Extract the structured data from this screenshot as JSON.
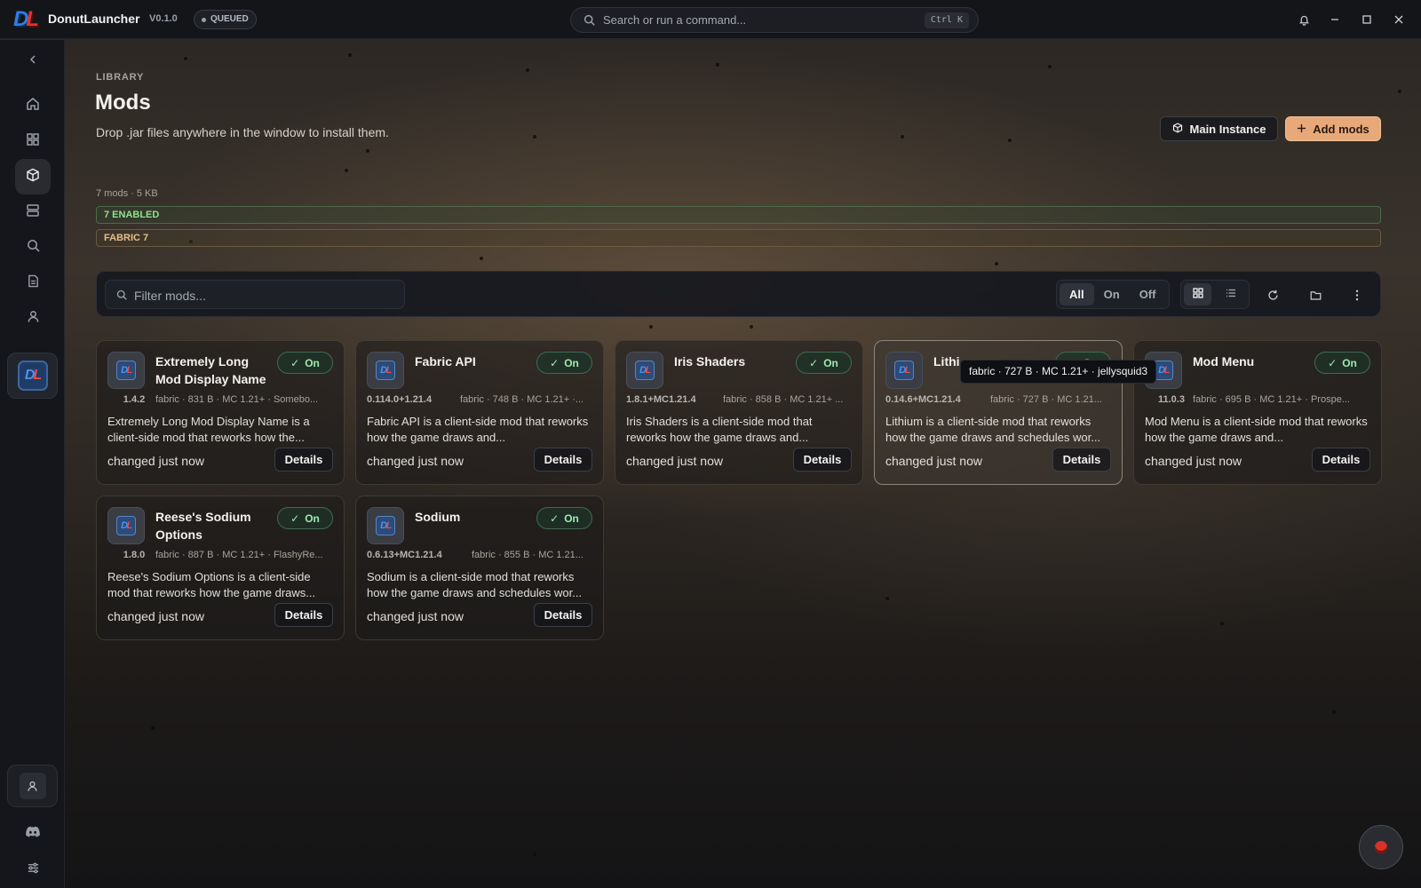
{
  "app": {
    "logo_letters": "DL",
    "name": "DonutLauncher",
    "version": "V0.1.0",
    "status_badge": "QUEUED"
  },
  "command_search": {
    "placeholder": "Search or run a command...",
    "shortcut": "Ctrl K"
  },
  "window_controls": [
    "bell-icon",
    "minimize-icon",
    "maximize-icon",
    "close-icon"
  ],
  "sidebar": {
    "collapse_icon": "chevron-left-icon",
    "items": [
      {
        "icon": "home-icon",
        "active": false
      },
      {
        "icon": "grid-icon",
        "active": false
      },
      {
        "icon": "package-icon",
        "active": true
      },
      {
        "icon": "servers-icon",
        "active": false
      },
      {
        "icon": "search-icon",
        "active": false
      },
      {
        "icon": "document-icon",
        "active": false
      },
      {
        "icon": "user-icon",
        "active": false
      }
    ],
    "instance_logo": "DL",
    "bottom": [
      "account-icon",
      "discord-icon",
      "sliders-icon"
    ]
  },
  "header": {
    "breadcrumb": "LIBRARY",
    "title": "Mods",
    "subtitle": "Drop .jar files anywhere in the window to install them.",
    "main_instance_label": "Main Instance",
    "add_mods_label": "Add mods"
  },
  "summary": {
    "stats": "7 mods · 5 KB",
    "enabled_chip": "7 ENABLED",
    "loader_chip": "FABRIC 7"
  },
  "toolbar": {
    "filter_placeholder": "Filter mods...",
    "filter_value": "",
    "segments": [
      "All",
      "On",
      "Off"
    ],
    "active_segment": "All",
    "view_modes": [
      "grid-icon",
      "list-icon"
    ],
    "active_view": "grid-icon"
  },
  "mods": [
    {
      "name": "Extremely Long Mod Display Name",
      "version": "1.4.2",
      "meta": "fabric · 831 B · MC 1.21+ · Somebo...",
      "desc": "Extremely Long Mod Display Name is a client-side mod that reworks how the...",
      "toggle": "On",
      "changed": "changed just now",
      "details": "Details"
    },
    {
      "name": "Fabric API",
      "version": "0.114.0+1.21.4",
      "meta": "fabric · 748 B · MC 1.21+ ·...",
      "desc": "Fabric API is a client-side mod that reworks how the game draws and...",
      "toggle": "On",
      "changed": "changed just now",
      "details": "Details"
    },
    {
      "name": "Iris Shaders",
      "version": "1.8.1+MC1.21.4",
      "meta": "fabric · 858 B · MC 1.21+ ...",
      "desc": "Iris Shaders is a client-side mod that reworks how the game draws and...",
      "toggle": "On",
      "changed": "changed just now",
      "details": "Details"
    },
    {
      "name": "Lithi",
      "version": "0.14.6+MC1.21.4",
      "meta": "fabric · 727 B · MC 1.21...",
      "desc": "Lithium is a client-side mod that reworks how the game draws and schedules wor...",
      "toggle": "On",
      "changed": "changed just now",
      "details": "Details"
    },
    {
      "name": "Mod Menu",
      "version": "11.0.3",
      "meta": "fabric · 695 B · MC 1.21+ · Prospe...",
      "desc": "Mod Menu is a client-side mod that reworks how the game draws and...",
      "toggle": "On",
      "changed": "changed just now",
      "details": "Details"
    },
    {
      "name": "Reese's Sodium Options",
      "version": "1.8.0",
      "meta": "fabric · 887 B · MC 1.21+ · FlashyRe...",
      "desc": "Reese's Sodium Options is a client-side mod that reworks how the game draws...",
      "toggle": "On",
      "changed": "changed just now",
      "details": "Details"
    },
    {
      "name": "Sodium",
      "version": "0.6.13+MC1.21.4",
      "meta": "fabric · 855 B · MC 1.21...",
      "desc": "Sodium is a client-side mod that reworks how the game draws and schedules wor...",
      "toggle": "On",
      "changed": "changed just now",
      "details": "Details"
    }
  ],
  "tooltip": "fabric · 727 B · MC 1.21+ · jellysquid3",
  "colors": {
    "accent": "#e8a97a",
    "enabled": "#8fe28d",
    "loader": "#e6c089",
    "toggle_on": "#9eeab0"
  }
}
